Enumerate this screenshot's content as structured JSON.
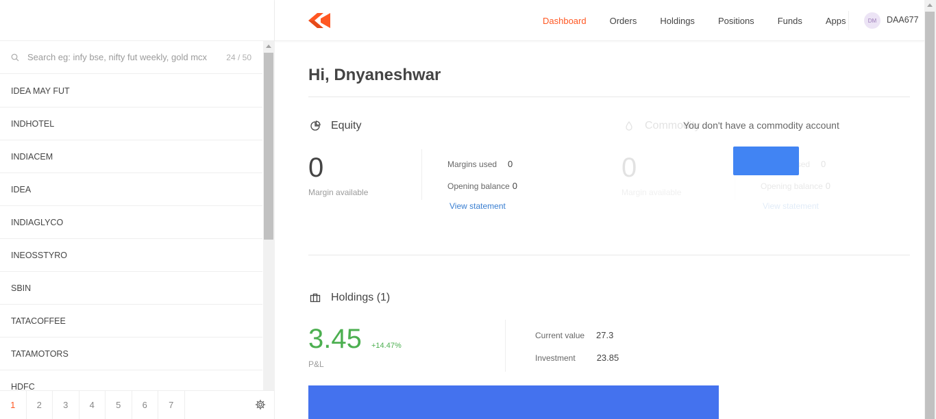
{
  "sidebar": {
    "search": {
      "placeholder": "Search eg: infy bse, nifty fut weekly, gold mcx",
      "count": "24 / 50"
    },
    "items": [
      {
        "label": "IDEA MAY FUT"
      },
      {
        "label": "INDHOTEL"
      },
      {
        "label": "INDIACEM"
      },
      {
        "label": "IDEA"
      },
      {
        "label": "INDIAGLYCO"
      },
      {
        "label": "INEOSSTYRO"
      },
      {
        "label": "SBIN"
      },
      {
        "label": "TATACOFFEE"
      },
      {
        "label": "TATAMOTORS"
      },
      {
        "label": "HDFC"
      }
    ],
    "pages": [
      "1",
      "2",
      "3",
      "4",
      "5",
      "6",
      "7"
    ],
    "active_page": "1"
  },
  "header": {
    "nav": [
      {
        "label": "Dashboard",
        "active": true
      },
      {
        "label": "Orders"
      },
      {
        "label": "Holdings"
      },
      {
        "label": "Positions"
      },
      {
        "label": "Funds"
      },
      {
        "label": "Apps"
      }
    ],
    "avatar_initials": "DM",
    "user_id": "DAA677"
  },
  "main": {
    "greeting": "Hi, Dnyaneshwar",
    "equity": {
      "title": "Equity",
      "margin_available": "0",
      "margin_available_label": "Margin available",
      "margins_used_label": "Margins used",
      "margins_used": "0",
      "opening_balance_label": "Opening balance",
      "opening_balance": "0",
      "view_statement": "View statement"
    },
    "commodity": {
      "title": "Commodity",
      "no_account_msg": "You don't have a commodity account",
      "margin_available": "0",
      "margin_available_label": "Margin available",
      "margins_used_label": "Margins used",
      "margins_used": "0",
      "opening_balance_label": "Opening balance",
      "opening_balance": "0",
      "view_statement": "View statement"
    },
    "holdings": {
      "title": "Holdings (1)",
      "pnl": "3.45",
      "pnl_pct": "+14.47%",
      "pnl_label": "P&L",
      "current_value_label": "Current value",
      "current_value": "27.3",
      "investment_label": "Investment",
      "investment": "23.85"
    }
  },
  "colors": {
    "accent": "#ff5722",
    "link": "#387ed1",
    "profit": "#4caf50",
    "button": "#4184f3",
    "holdings_bar": "#4472ee"
  }
}
